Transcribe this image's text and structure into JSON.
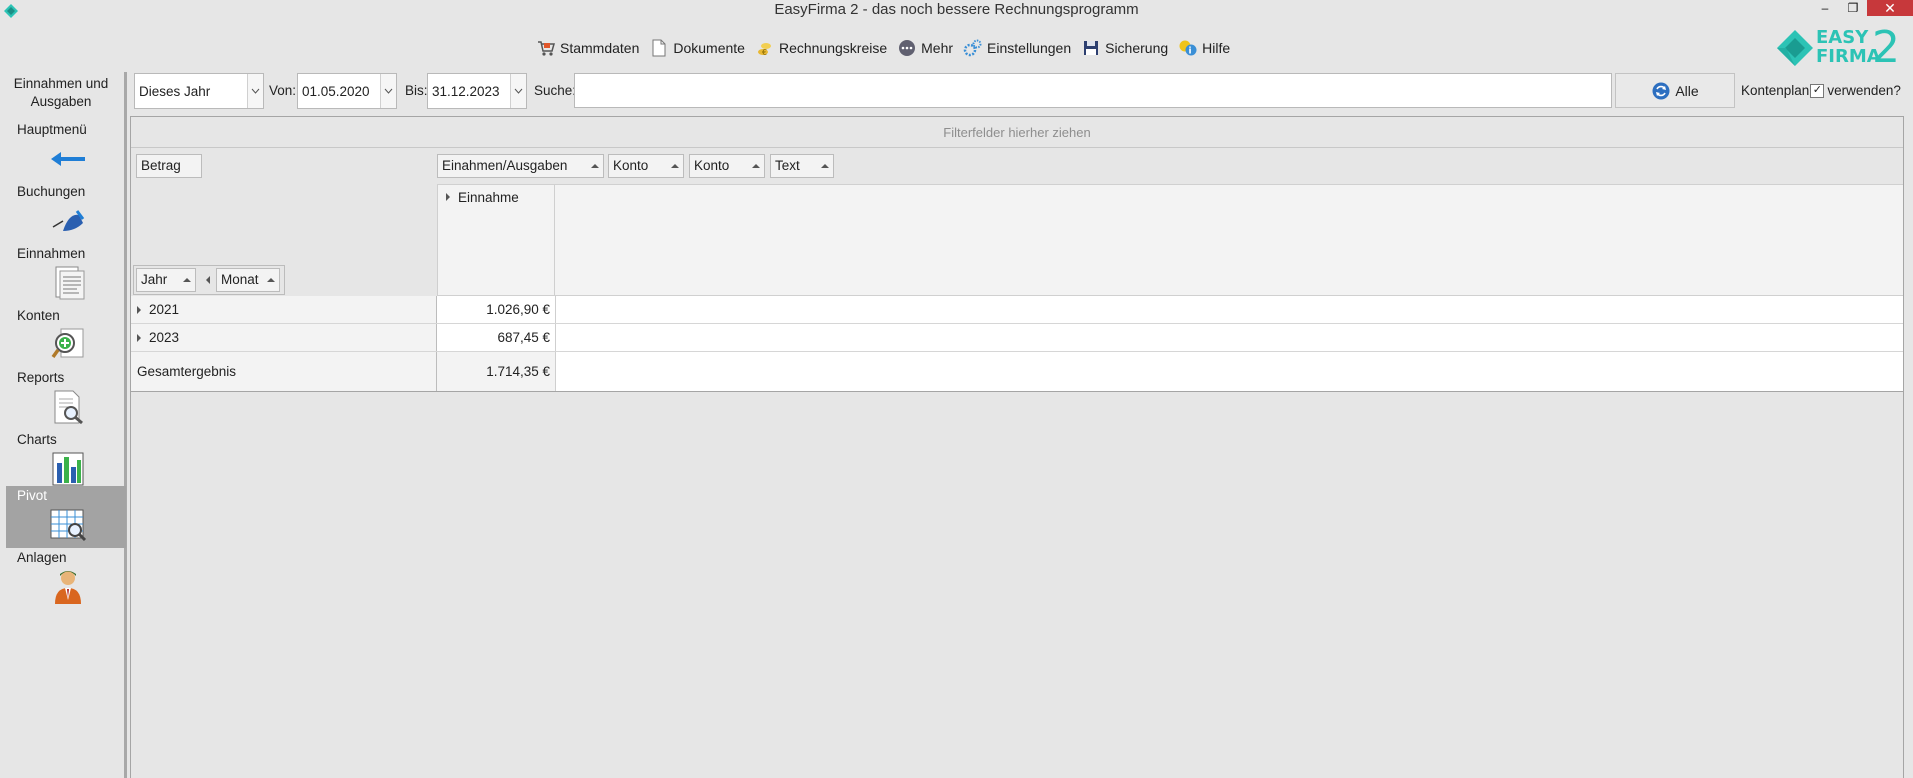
{
  "window": {
    "title": "EasyFirma 2 - das noch bessere Rechnungsprogramm",
    "minimize": "–",
    "restore": "❐",
    "close": "✕"
  },
  "menu": [
    {
      "label": "Stammdaten",
      "icon": "cart-icon"
    },
    {
      "label": "Dokumente",
      "icon": "document-icon"
    },
    {
      "label": "Rechnungskreise",
      "icon": "coins-icon"
    },
    {
      "label": "Mehr",
      "icon": "more-icon"
    },
    {
      "label": "Einstellungen",
      "icon": "gears-icon"
    },
    {
      "label": "Sicherung",
      "icon": "floppy-icon"
    },
    {
      "label": "Hilfe",
      "icon": "help-icon"
    }
  ],
  "logo": {
    "line1": "EASY",
    "line2": "FIRMA",
    "two": "2"
  },
  "sidebar": {
    "header": [
      "Einnahmen und",
      "Ausgaben"
    ],
    "items": [
      {
        "label": "Hauptmenü",
        "icon": "back-arrow-icon"
      },
      {
        "label": "Buchungen",
        "icon": "pen-icon"
      },
      {
        "label": "Einnahmen",
        "icon": "receipt-icon"
      },
      {
        "label": "Konten",
        "icon": "zoom-add-icon"
      },
      {
        "label": "Reports",
        "icon": "report-search-icon"
      },
      {
        "label": "Charts",
        "icon": "bar-chart-icon"
      },
      {
        "label": "Pivot",
        "icon": "pivot-table-icon"
      },
      {
        "label": "Anlagen",
        "icon": "person-icon"
      }
    ]
  },
  "toolbar": {
    "period": "Dieses Jahr",
    "von_label": "Von:",
    "von_value": "01.05.2020",
    "bis_label": "Bis:",
    "bis_value": "31.12.2023",
    "search_label": "Suche:",
    "search_value": "",
    "alle_label": "Alle",
    "kontenplan_label": "Kontenplan",
    "kontenplan_checked": "✓",
    "verwenden_label": "verwenden?"
  },
  "pivot": {
    "filter_hint": "Filterfelder hierher ziehen",
    "data_field": "Betrag",
    "column_fields": [
      "Einahmen/Ausgaben",
      "Konto",
      "Konto",
      "Text"
    ],
    "row_fields": [
      "Jahr",
      "Monat"
    ],
    "column_value": "Einnahme",
    "rows": [
      {
        "label": "2021",
        "value": "1.026,90 €"
      },
      {
        "label": "2023",
        "value": "687,45 €"
      }
    ],
    "total": {
      "label": "Gesamtergebnis",
      "value": "1.714,35 €"
    }
  }
}
